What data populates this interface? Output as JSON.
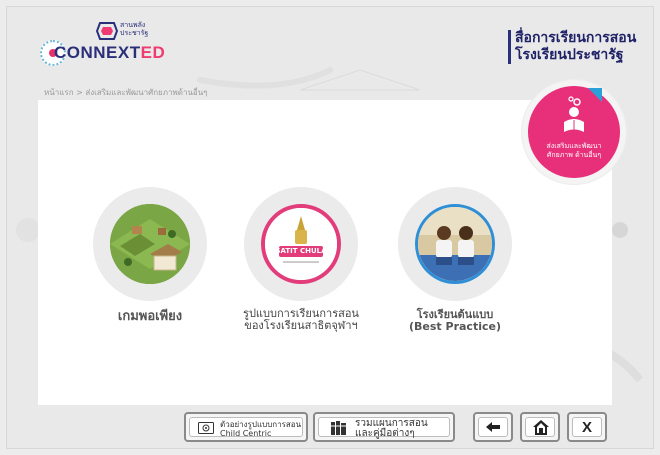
{
  "header": {
    "logo_small": [
      "สานพลัง",
      "ประชารัฐ"
    ],
    "logo_text_main": "CONNEXT",
    "logo_text_accent": "ED",
    "title_lines": [
      "สื่อการเรียนการสอน",
      "โรงเรียนประชารัฐ"
    ]
  },
  "breadcrumb": "หน้าแรก  >  ส่งเสริมและพัฒนาศักยภาพด้านอื่นๆ",
  "category_badge": {
    "label_lines": [
      "ส่งเสริมและพัฒนา",
      "ศักยภาพ ด้านอื่นๆ"
    ]
  },
  "menu": [
    {
      "label_lines": [
        "เกมพอเพียง"
      ]
    },
    {
      "label_lines": [
        "รูปแบบการเรียนการสอน",
        "ของโรงเรียนสาธิตจุฬาฯ"
      ],
      "logo_text": "SATIT CHULA"
    },
    {
      "label_lines": [
        "โรงเรียนต้นแบบ",
        "(Best Practice)"
      ]
    }
  ],
  "footer": {
    "example_button": {
      "lines": [
        "ตัวอย่างรูปแบบการสอน",
        "Child Centric"
      ]
    },
    "collection_button": {
      "lines": [
        "รวมแผนการสอน",
        "และคู่มือต่างๆ"
      ]
    },
    "close_label": "X"
  },
  "colors": {
    "accent_pink": "#e8307a",
    "brand_navy": "#2b2f7a",
    "badge_corner_blue": "#2a9fd8"
  },
  "icons": [
    "gear-icon",
    "reader-icon",
    "video-icon",
    "books-icon",
    "back-arrow-icon",
    "home-icon"
  ]
}
